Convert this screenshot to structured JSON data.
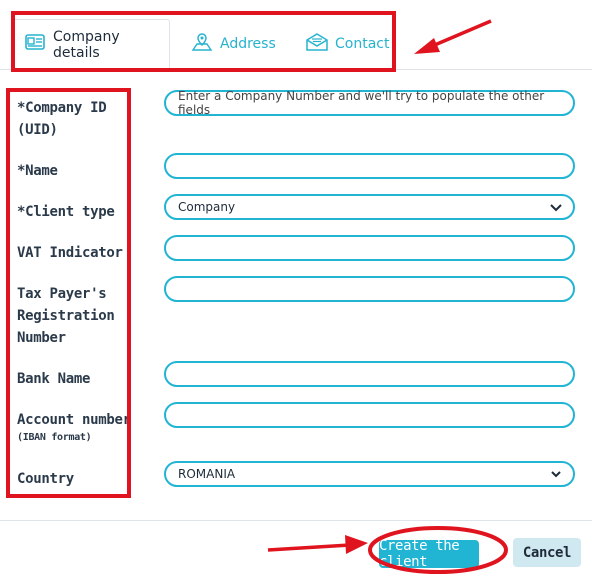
{
  "tabs": [
    {
      "label": "Company details",
      "icon": "company-card-icon",
      "active": true
    },
    {
      "label": "Address",
      "icon": "map-pin-icon",
      "active": false
    },
    {
      "label": "Contact",
      "icon": "envelope-icon",
      "active": false
    }
  ],
  "form": {
    "company_id": {
      "required": "*",
      "label": "Company ID",
      "label2": "(UID)",
      "placeholder": "Enter a Company Number and we'll try to populate the other fields"
    },
    "name": {
      "required": "*",
      "label": "Name",
      "value": ""
    },
    "client_type": {
      "required": "*",
      "label": "Client type",
      "value": "Company"
    },
    "vat": {
      "label": "VAT Indicator",
      "value": ""
    },
    "tax_payer": {
      "label1": "Tax Payer's",
      "label2": "Registration",
      "label3": "Number",
      "value": ""
    },
    "bank_name": {
      "label": "Bank Name",
      "value": ""
    },
    "account_number": {
      "label": "Account number",
      "hint": "(IBAN format)",
      "value": ""
    },
    "country": {
      "label": "Country",
      "value": "ROMANIA"
    }
  },
  "footer": {
    "create_label": "Create the client",
    "cancel_label": "Cancel"
  },
  "colors": {
    "accent": "#22b4d3",
    "annotation": "#e0141e"
  }
}
